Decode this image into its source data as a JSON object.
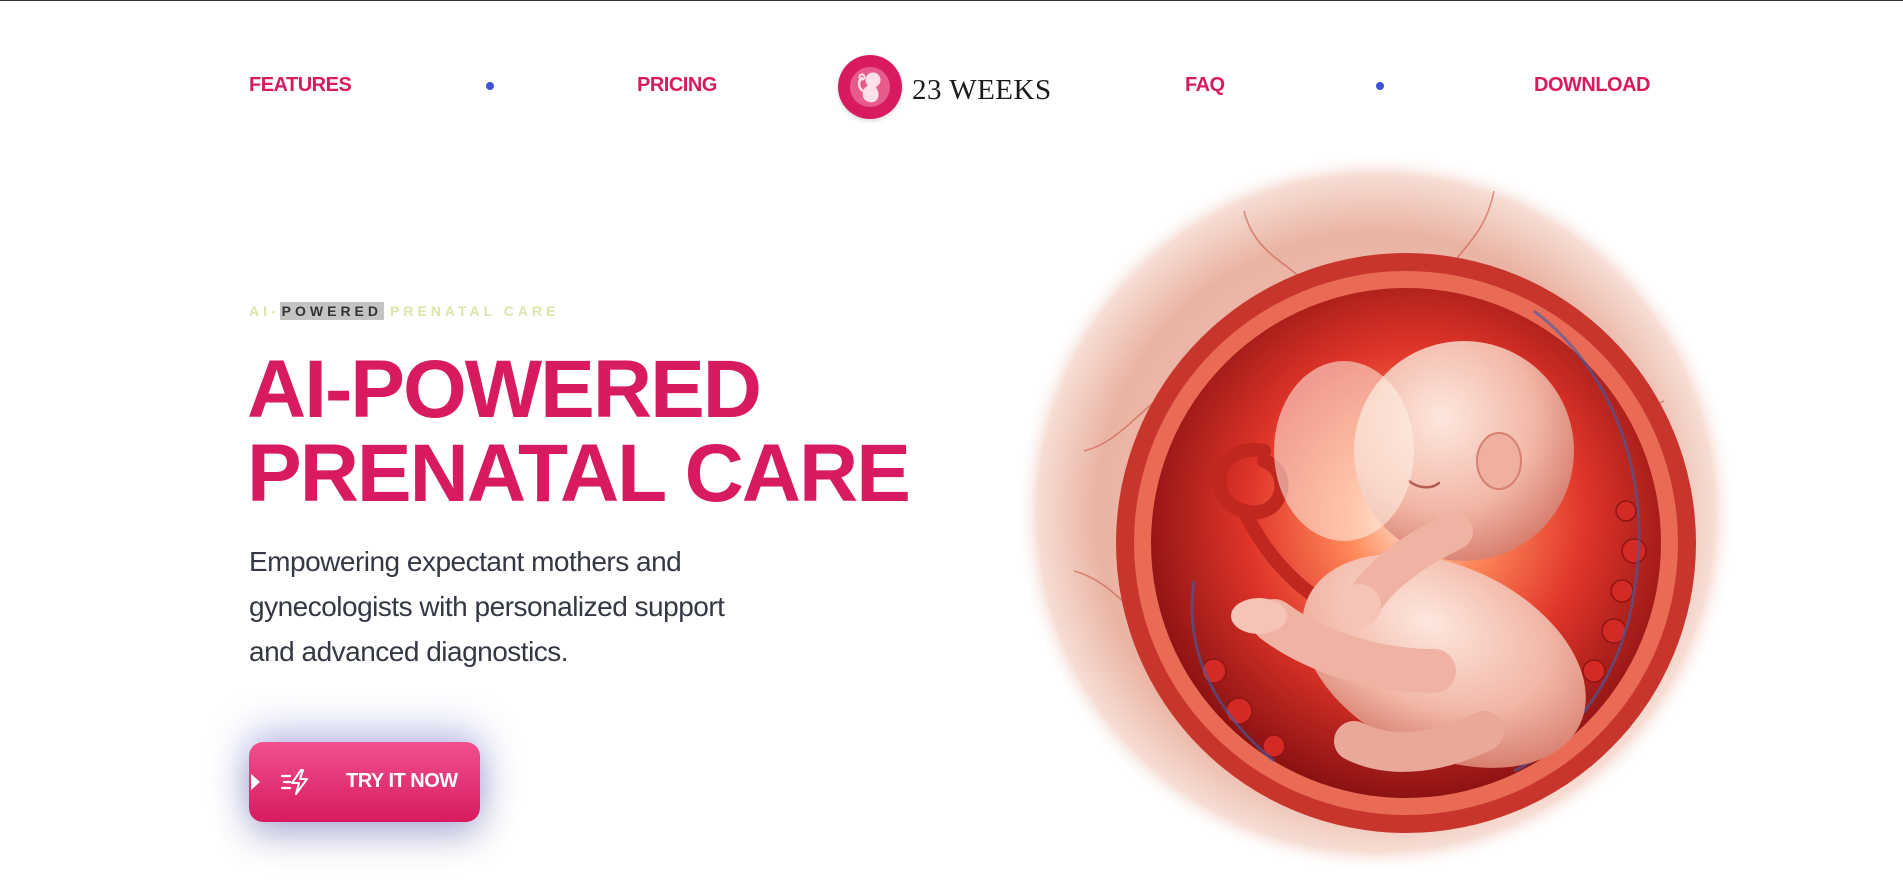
{
  "nav": {
    "left_links": [
      {
        "label": "FEATURES"
      },
      {
        "label": "PRICING"
      }
    ],
    "right_links": [
      {
        "label": "FAQ"
      },
      {
        "label": "DOWNLOAD"
      }
    ],
    "brand": {
      "name": "23 WEEKS",
      "logo_icon": "fetus-logo-icon"
    },
    "separator_icon": "dot-icon"
  },
  "hero": {
    "eyebrow": {
      "prefix": "AI-",
      "highlight": "POWERED",
      "suffix": "PRENATAL CARE"
    },
    "title_lines": [
      "AI-POWERED",
      "PRENATAL CARE"
    ],
    "description_lines": [
      "Empowering expectant mothers and",
      "gynecologists with personalized support",
      "and advanced diagnostics."
    ],
    "cta": {
      "label": "TRY IT NOW",
      "icon": "lightning-icon"
    },
    "illustration": "fetus-in-womb-illustration"
  },
  "colors": {
    "accent": "#d81b60",
    "dot": "#3f51d6",
    "eyebrow": "#d9e6a8",
    "body_text": "#333844"
  }
}
